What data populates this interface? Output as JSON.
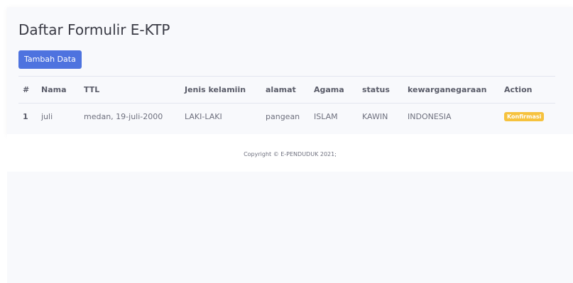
{
  "page": {
    "title": "Daftar Formulir E-KTP",
    "add_button_label": "Tambah Data"
  },
  "table": {
    "headers": [
      "#",
      "Nama",
      "TTL",
      "Jenis kelamiin",
      "alamat",
      "Agama",
      "status",
      "kewarganegaraan",
      "Action"
    ],
    "rows": [
      {
        "no": "1",
        "nama": "juli",
        "ttl": "medan, 19-juli-2000",
        "jenis_kelamin": "LAKI-LAKI",
        "alamat": "pangean",
        "agama": "ISLAM",
        "status": "KAWIN",
        "kewarganegaraan": "INDONESIA",
        "action_label": "Konfirmasi"
      }
    ]
  },
  "footer": {
    "copyright": "Copyright © E-PENDUDUK 2021;"
  },
  "colors": {
    "primary": "#4e73df",
    "warning": "#f6c23e",
    "background": "#f8f9fc",
    "text": "#5a5c69"
  }
}
